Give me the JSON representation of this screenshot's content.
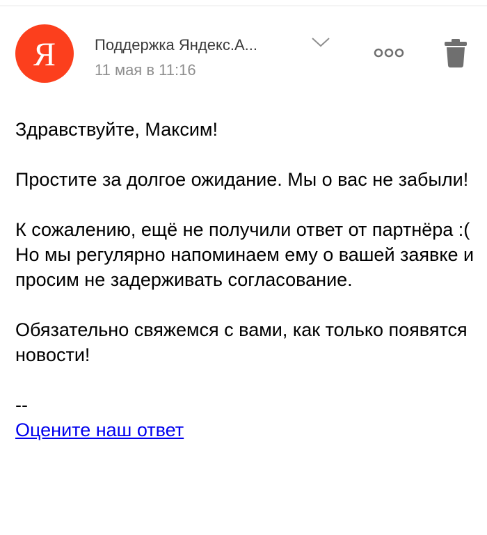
{
  "header": {
    "avatar_letter": "Я",
    "sender": "Поддержка Яндекс.А...",
    "date": "11 мая в 11:16",
    "icons": {
      "expand": "chevron-down-icon",
      "more": "more-options-icon",
      "delete": "trash-icon"
    },
    "colors": {
      "avatar": "#fc3f1d",
      "date": "#8e8e8e",
      "icon": "#6f6f6f"
    }
  },
  "message": {
    "greeting": "Здравствуйте, Максим!",
    "para1": "Простите за долгое ожидание. Мы о вас не забыли!",
    "para2_line1": "К сожалению, ещё не получили ответ от партнёра :(",
    "para2_line2": "Но мы регулярно напоминаем ему о вашей заявке и просим не задерживать согласование.",
    "para3": "Обязательно свяжемся с вами, как только появятся новости!",
    "signature_sep": "--",
    "rate_link": "Оцените наш ответ",
    "link_color": "#0000ee"
  }
}
